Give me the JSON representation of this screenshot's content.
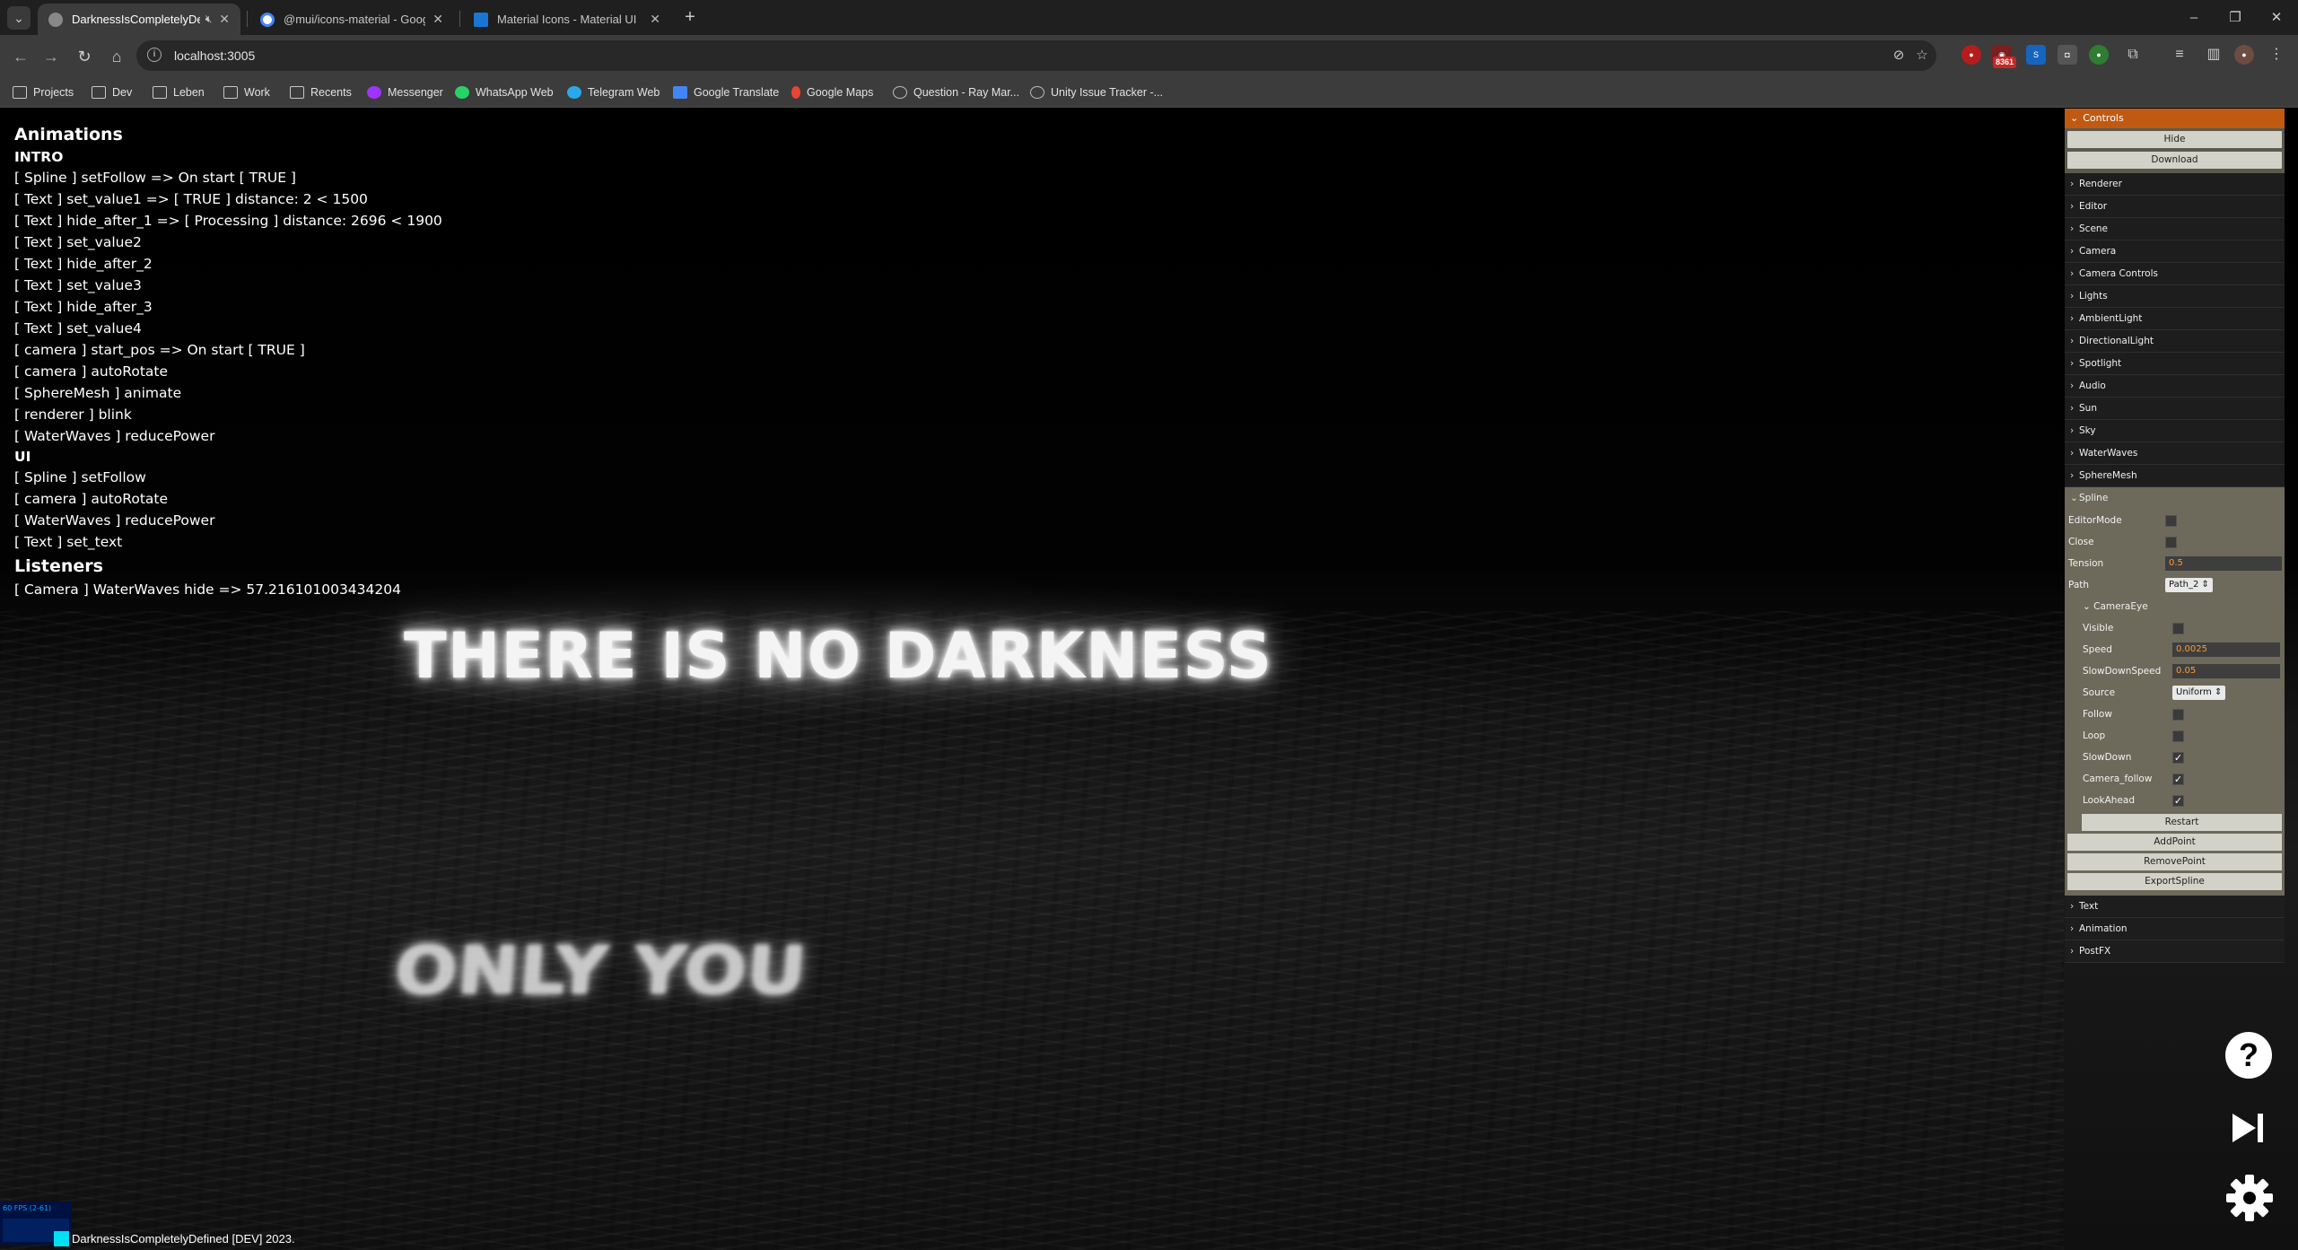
{
  "browser": {
    "tabs": [
      {
        "title": "DarknessIsCompletelyDefin",
        "active": true
      },
      {
        "title": "@mui/icons-material - Google",
        "active": false
      },
      {
        "title": "Material Icons - Material UI",
        "active": false
      }
    ],
    "url": "localhost:3005",
    "extension_badge": "8361",
    "bookmarks": [
      "Projects",
      "Dev",
      "Leben",
      "Work",
      "Recents",
      "Messenger",
      "WhatsApp Web",
      "Telegram Web",
      "Google Translate",
      "Google Maps",
      "Question - Ray Mar...",
      "Unity Issue Tracker -..."
    ]
  },
  "log": {
    "animations_heading": "Animations",
    "intro_heading": "INTRO",
    "intro_lines": [
      "[ Spline ] setFollow => On start [ TRUE ]",
      "[ Text ] set_value1 => [ TRUE ] distance: 2 < 1500",
      "[ Text ] hide_after_1 => [ Processing ] distance: 2696 < 1900",
      "[ Text ] set_value2",
      "[ Text ] hide_after_2",
      "[ Text ] set_value3",
      "[ Text ] hide_after_3",
      "[ Text ] set_value4",
      "[ camera ] start_pos => On start [ TRUE ]",
      "[ camera ] autoRotate",
      "[ SphereMesh ] animate",
      "[ renderer ] blink",
      "[ WaterWaves ] reducePower"
    ],
    "ui_heading": "UI",
    "ui_lines": [
      "[ Spline ] setFollow",
      "[ camera ] autoRotate",
      "[ WaterWaves ] reducePower",
      "[ Text ] set_text"
    ],
    "listeners_heading": "Listeners",
    "listener_lines": [
      "[ Camera ] WaterWaves hide => 57.216101003434204"
    ]
  },
  "scene": {
    "headline": "THERE IS NO DARKNESS",
    "reflection": "ONLY YOU"
  },
  "controls": {
    "title": "Controls",
    "hide_label": "Hide",
    "download_label": "Download",
    "folders_top": [
      "Renderer",
      "Editor",
      "Scene",
      "Camera",
      "Camera Controls",
      "Lights",
      "AmbientLight",
      "DirectionalLight",
      "Spotlight",
      "Audio",
      "Sun",
      "Sky",
      "WaterWaves",
      "SphereMesh"
    ],
    "spline": {
      "title": "Spline",
      "editor_mode_label": "EditorMode",
      "close_label": "Close",
      "tension_label": "Tension",
      "tension_value": "0.5",
      "path_label": "Path",
      "path_value": "Path_2",
      "camera_eye": {
        "title": "CameraEye",
        "visible_label": "Visible",
        "speed_label": "Speed",
        "speed_value": "0.0025",
        "slowdown_speed_label": "SlowDownSpeed",
        "slowdown_speed_value": "0.05",
        "source_label": "Source",
        "source_value": "Uniform",
        "follow_label": "Follow",
        "loop_label": "Loop",
        "slowdown_label": "SlowDown",
        "camera_follow_label": "Camera_follow",
        "lookahead_label": "LookAhead",
        "restart_label": "Restart"
      },
      "add_point_label": "AddPoint",
      "remove_point_label": "RemovePoint",
      "export_spline_label": "ExportSpline"
    },
    "folders_bottom": [
      "Text",
      "Animation",
      "PostFX"
    ]
  },
  "stats": {
    "fps_label": "60 FPS (2-61)"
  },
  "footer": {
    "text": "DarknessIsCompletelyDefined [DEV] 2023."
  }
}
